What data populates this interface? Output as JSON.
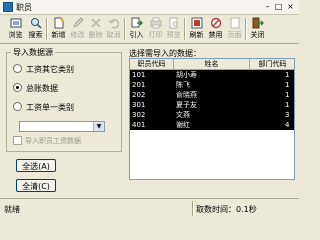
{
  "window": {
    "title": "职员",
    "minimize": "–",
    "maximize": "□",
    "close": "×"
  },
  "toolbar": {
    "browse": "浏览",
    "search": "搜索",
    "new": "新增",
    "edit": "修改",
    "delete": "删除",
    "cancel": "取消",
    "import": "引入",
    "print": "打印",
    "preview": "预览",
    "refresh": "刷新",
    "disable": "禁用",
    "page": "页面",
    "close": "关闭"
  },
  "source_group": {
    "title": "导入数据源",
    "options": [
      "工资其它类别",
      "总账数据",
      "工资单一类别"
    ],
    "selected_index": 1,
    "select_value": "",
    "checkbox_label": "导入职员工资数据",
    "checkbox_checked": false
  },
  "buttons": {
    "select_all": "全选(A)",
    "clear_all": "全清(C)"
  },
  "grid": {
    "label": "选择需导入的数据：",
    "columns": [
      "职员代码",
      "姓名",
      "部门代码"
    ],
    "rows": [
      [
        "101",
        "胡小寿",
        "1"
      ],
      [
        "201",
        "陈飞",
        "1"
      ],
      [
        "202",
        "俞晓燕",
        "1"
      ],
      [
        "301",
        "夏子友",
        "1"
      ],
      [
        "302",
        "文燕",
        "3"
      ],
      [
        "401",
        "谢红",
        "4"
      ]
    ]
  },
  "status": {
    "left": "就绪",
    "right": "取数时间：0.1秒"
  }
}
